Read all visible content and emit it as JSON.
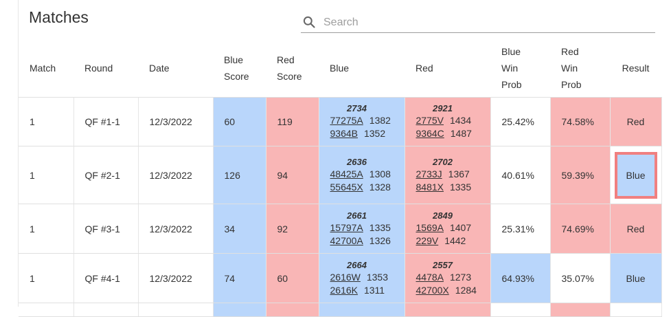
{
  "title": "Matches",
  "search": {
    "placeholder": "Search"
  },
  "headers": {
    "match": "Match",
    "round": "Round",
    "date": "Date",
    "blue_score": [
      "Blue",
      "Score"
    ],
    "red_score": [
      "Red",
      "Score"
    ],
    "blue": "Blue",
    "red": "Red",
    "blue_win_prob": [
      "Blue",
      "Win",
      "Prob"
    ],
    "red_win_prob": [
      "Red",
      "Win",
      "Prob"
    ],
    "result": "Result"
  },
  "colors": {
    "blue": "#b9d6fb",
    "red": "#f9b6b6",
    "highlight_border": "#f08080"
  },
  "rows": [
    {
      "match": "1",
      "round": "QF #1-1",
      "date": "12/3/2022",
      "blue_score": "60",
      "red_score": "119",
      "blue_total": "2734",
      "blue_teams": [
        {
          "team": "77275A",
          "rating": "1382"
        },
        {
          "team": "9364B",
          "rating": "1352"
        }
      ],
      "red_total": "2921",
      "red_teams": [
        {
          "team": "2775V",
          "rating": "1434"
        },
        {
          "team": "9364C",
          "rating": "1487"
        }
      ],
      "blue_win_prob": "25.42%",
      "red_win_prob": "74.58%",
      "result": "Red"
    },
    {
      "match": "1",
      "round": "QF #2-1",
      "date": "12/3/2022",
      "blue_score": "126",
      "red_score": "94",
      "blue_total": "2636",
      "blue_teams": [
        {
          "team": "48425A",
          "rating": "1308"
        },
        {
          "team": "55645X",
          "rating": "1328"
        }
      ],
      "red_total": "2702",
      "red_teams": [
        {
          "team": "2733J",
          "rating": "1367"
        },
        {
          "team": "8481X",
          "rating": "1335"
        }
      ],
      "blue_win_prob": "40.61%",
      "red_win_prob": "59.39%",
      "result": "Blue"
    },
    {
      "match": "1",
      "round": "QF #3-1",
      "date": "12/3/2022",
      "blue_score": "34",
      "red_score": "92",
      "blue_total": "2661",
      "blue_teams": [
        {
          "team": "15797A",
          "rating": "1335"
        },
        {
          "team": "42700A",
          "rating": "1326"
        }
      ],
      "red_total": "2849",
      "red_teams": [
        {
          "team": "1569A",
          "rating": "1407"
        },
        {
          "team": "229V",
          "rating": "1442"
        }
      ],
      "blue_win_prob": "25.31%",
      "red_win_prob": "74.69%",
      "result": "Red"
    },
    {
      "match": "1",
      "round": "QF #4-1",
      "date": "12/3/2022",
      "blue_score": "74",
      "red_score": "60",
      "blue_total": "2664",
      "blue_teams": [
        {
          "team": "2616W",
          "rating": "1353"
        },
        {
          "team": "2616K",
          "rating": "1311"
        }
      ],
      "red_total": "2557",
      "red_teams": [
        {
          "team": "4478A",
          "rating": "1273"
        },
        {
          "team": "42700X",
          "rating": "1284"
        }
      ],
      "blue_win_prob": "64.93%",
      "red_win_prob": "35.07%",
      "result": "Blue"
    }
  ]
}
